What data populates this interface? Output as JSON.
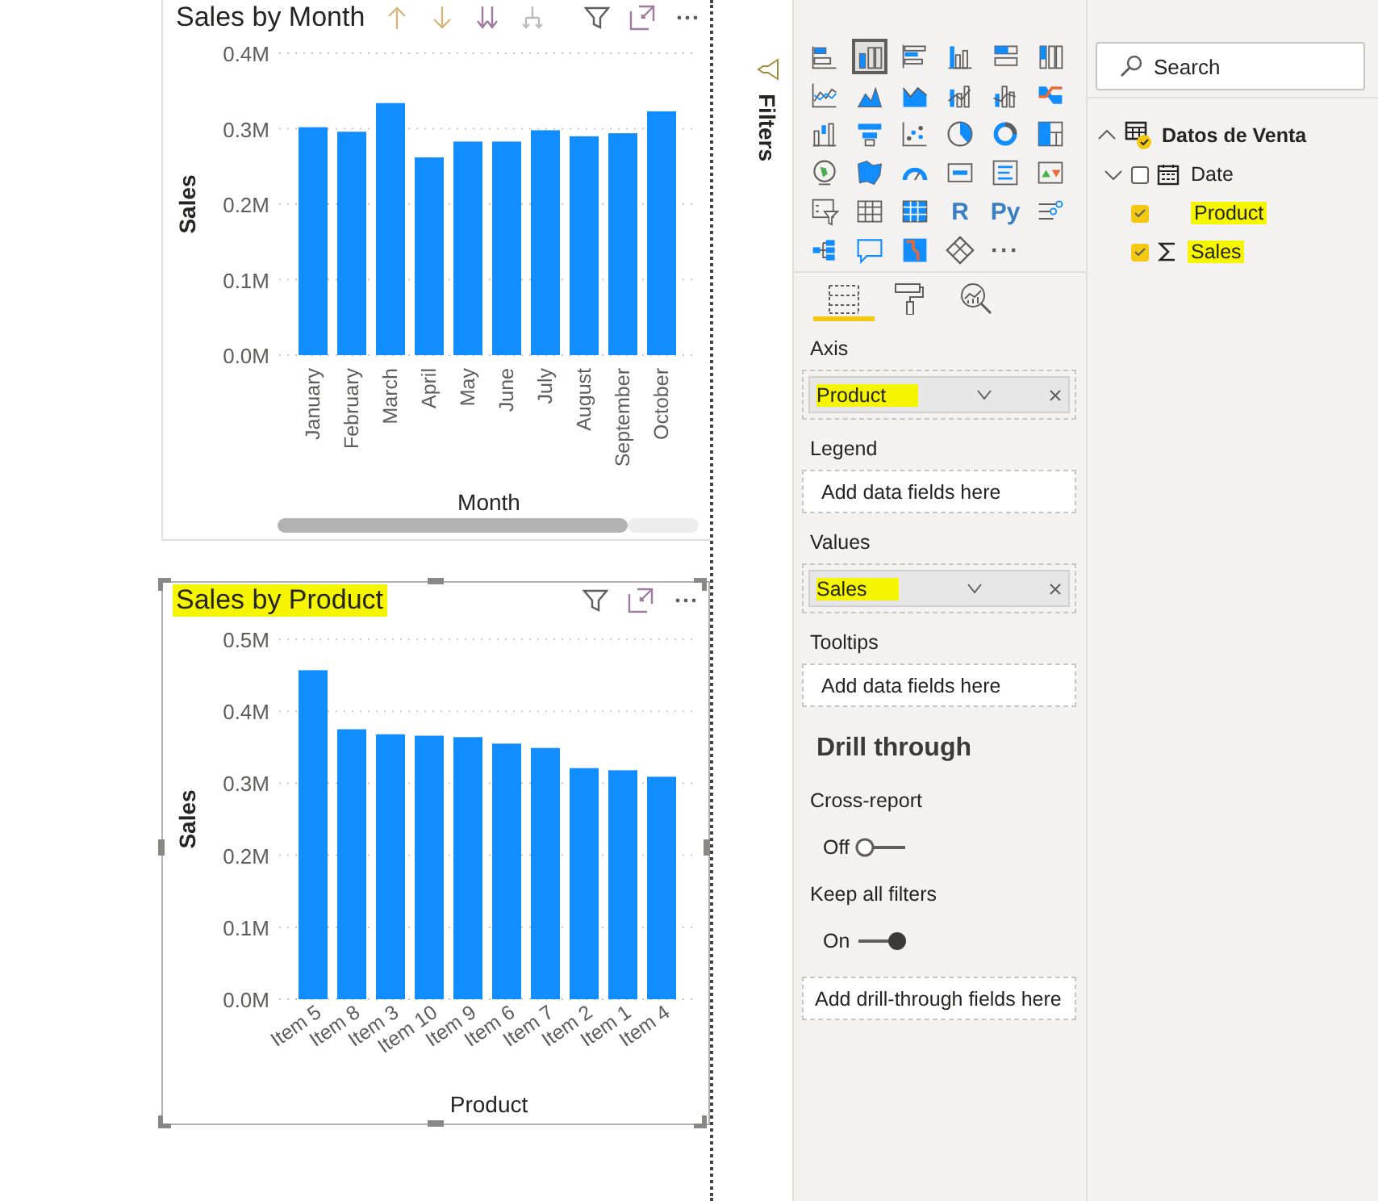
{
  "charts": [
    {
      "title": "Sales by Month",
      "highlighted": false,
      "selected": false,
      "drill_controls": true,
      "chart_data": {
        "type": "bar",
        "grid": true,
        "xlabel": "Month",
        "ylabel": "Sales",
        "categories": [
          "January",
          "February",
          "March",
          "April",
          "May",
          "June",
          "July",
          "August",
          "September",
          "October"
        ],
        "values": [
          0.302,
          0.296,
          0.334,
          0.262,
          0.283,
          0.283,
          0.298,
          0.29,
          0.294,
          0.323
        ],
        "ylim": [
          0,
          0.4
        ],
        "yticks": [
          {
            "value": 0,
            "label": "0.0M"
          },
          {
            "value": 0.1,
            "label": "0.1M"
          },
          {
            "value": 0.2,
            "label": "0.2M"
          },
          {
            "value": 0.3,
            "label": "0.3M"
          },
          {
            "value": 0.4,
            "label": "0.4M"
          }
        ]
      }
    },
    {
      "title": "Sales by Product",
      "highlighted": true,
      "selected": true,
      "drill_controls": false,
      "chart_data": {
        "type": "bar",
        "grid": true,
        "xlabel": "Product",
        "ylabel": "Sales",
        "categories": [
          "Item 5",
          "Item 8",
          "Item 3",
          "Item 10",
          "Item 9",
          "Item 6",
          "Item 7",
          "Item 2",
          "Item 1",
          "Item 4"
        ],
        "values": [
          0.457,
          0.375,
          0.368,
          0.366,
          0.364,
          0.355,
          0.349,
          0.321,
          0.318,
          0.309
        ],
        "ylim": [
          0,
          0.5
        ],
        "yticks": [
          {
            "value": 0,
            "label": "0.0M"
          },
          {
            "value": 0.1,
            "label": "0.1M"
          },
          {
            "value": 0.2,
            "label": "0.2M"
          },
          {
            "value": 0.3,
            "label": "0.3M"
          },
          {
            "value": 0.4,
            "label": "0.4M"
          },
          {
            "value": 0.5,
            "label": "0.5M"
          }
        ]
      }
    }
  ],
  "filters_pane": {
    "label": "Filters"
  },
  "visualizations": {
    "icons": [
      {
        "selected": false
      },
      {
        "selected": true
      },
      {
        "selected": false
      },
      {
        "selected": false
      },
      {
        "selected": false
      },
      {
        "selected": false
      },
      {
        "selected": false
      },
      {
        "selected": false
      },
      {
        "selected": false
      },
      {
        "selected": false
      },
      {
        "selected": false
      },
      {
        "selected": false
      },
      {
        "selected": false
      },
      {
        "selected": false
      },
      {
        "selected": false
      },
      {
        "selected": false
      },
      {
        "selected": false
      },
      {
        "selected": false
      },
      {
        "selected": false
      },
      {
        "selected": false
      },
      {
        "selected": false
      },
      {
        "selected": false
      },
      {
        "selected": false
      },
      {
        "selected": false
      },
      {
        "selected": false
      },
      {
        "selected": false
      },
      {
        "selected": false
      },
      {
        "label": "R",
        "selected": false
      },
      {
        "label": "Py",
        "selected": false
      },
      {
        "selected": false
      },
      {
        "selected": false
      },
      {
        "selected": false
      },
      {
        "selected": false
      },
      {
        "selected": false
      },
      {
        "label": "···",
        "selected": false
      }
    ],
    "tabs": [
      {
        "selected": true
      },
      {
        "selected": false
      },
      {
        "selected": false
      }
    ],
    "wells": [
      {
        "label": "Axis",
        "fields": [
          {
            "name": "Product",
            "highlighted": true
          }
        ]
      },
      {
        "label": "Legend",
        "placeholder": "Add data fields here"
      },
      {
        "label": "Values",
        "fields": [
          {
            "name": "Sales",
            "highlighted": true
          }
        ]
      },
      {
        "label": "Tooltips",
        "placeholder": "Add data fields here"
      }
    ],
    "drill_through": {
      "heading": "Drill through",
      "toggles": [
        {
          "label": "Cross-report",
          "state_label": "Off",
          "on": false
        },
        {
          "label": "Keep all filters",
          "state_label": "On",
          "on": true
        }
      ],
      "placeholder": "Add drill-through fields here"
    }
  },
  "fields": {
    "search": {
      "placeholder": "Search"
    },
    "tables": [
      {
        "name": "Datos de Venta",
        "expanded": true,
        "children": [
          {
            "name": "Date",
            "kind": "date",
            "expanded": false,
            "checked": false,
            "highlighted": false
          },
          {
            "name": "Product",
            "kind": "column",
            "checked": true,
            "highlighted": true
          },
          {
            "name": "Sales",
            "kind": "measure",
            "checked": true,
            "highlighted": true
          }
        ]
      }
    ]
  }
}
